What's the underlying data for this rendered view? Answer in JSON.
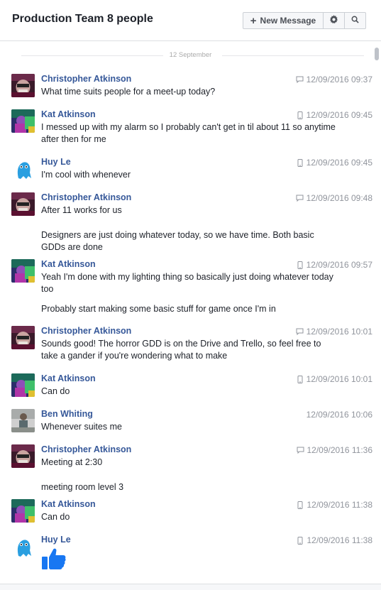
{
  "header": {
    "title": "Production Team 8 people",
    "new_message_label": "New Message"
  },
  "date_separator": "12 September",
  "messages": [
    {
      "sender": "Christopher Atkinson",
      "avatar": "christopher-avatar",
      "device": "chat-icon",
      "time": "12/09/2016 09:37",
      "lines": [
        "What time suits people for a meet-up today?"
      ]
    },
    {
      "sender": "Kat Atkinson",
      "avatar": "kat-avatar",
      "device": "mobile-icon",
      "time": "12/09/2016 09:45",
      "lines": [
        "I messed up with my alarm so I probably can't get in til about 11 so anytime after then for me"
      ]
    },
    {
      "sender": "Huy Le",
      "avatar": "huy-avatar",
      "device": "mobile-icon",
      "time": "12/09/2016 09:45",
      "lines": [
        "I'm  cool with whenever"
      ]
    },
    {
      "sender": "Christopher Atkinson",
      "avatar": "christopher-avatar",
      "device": "chat-icon",
      "time": "12/09/2016 09:48",
      "lines": [
        "After 11 works for us",
        "Designers are just doing whatever today, so we have time. Both basic GDDs are done"
      ]
    },
    {
      "sender": "Kat Atkinson",
      "avatar": "kat-avatar",
      "device": "mobile-icon",
      "time": "12/09/2016 09:57",
      "lines": [
        "Yeah I'm done with my lighting thing so basically just doing whatever today too",
        "Probably start making some basic stuff for game once I'm in"
      ]
    },
    {
      "sender": "Christopher Atkinson",
      "avatar": "christopher-avatar",
      "device": "chat-icon",
      "time": "12/09/2016 10:01",
      "lines": [
        "Sounds good! The horror GDD is on the Drive and Trello, so feel free to take a gander if you're wondering what to make"
      ]
    },
    {
      "sender": "Kat Atkinson",
      "avatar": "kat-avatar",
      "device": "mobile-icon",
      "time": "12/09/2016 10:01",
      "lines": [
        "Can do"
      ]
    },
    {
      "sender": "Ben Whiting",
      "avatar": "ben-avatar",
      "device": "none",
      "time": "12/09/2016 10:06",
      "lines": [
        "Whenever suites me"
      ]
    },
    {
      "sender": "Christopher Atkinson",
      "avatar": "christopher-avatar",
      "device": "chat-icon",
      "time": "12/09/2016 11:36",
      "lines": [
        "Meeting at 2:30",
        "meeting room level 3"
      ]
    },
    {
      "sender": "Kat Atkinson",
      "avatar": "kat-avatar",
      "device": "mobile-icon",
      "time": "12/09/2016 11:38",
      "lines": [
        "Can do"
      ]
    },
    {
      "sender": "Huy Le",
      "avatar": "huy-avatar",
      "device": "mobile-icon",
      "time": "12/09/2016 11:38",
      "lines": [],
      "sticker": "thumbs-up-icon"
    }
  ],
  "colors": {
    "name": "#365899",
    "meta": "#90949c",
    "thumb": "#1877f2"
  }
}
